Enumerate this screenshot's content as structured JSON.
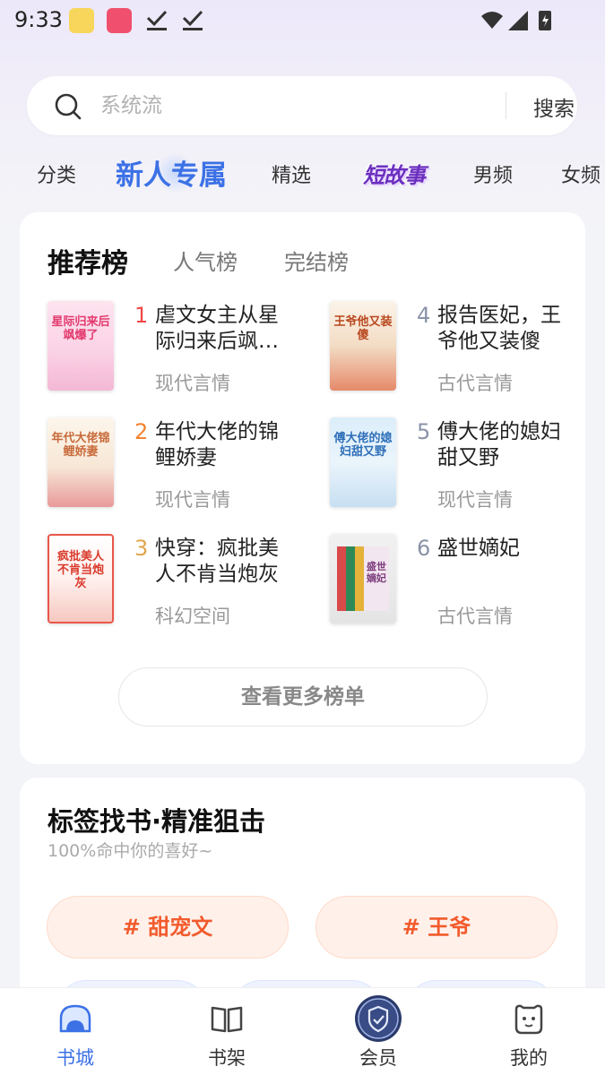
{
  "status_bar": {
    "time": "9:33"
  },
  "search": {
    "placeholder": "系统流",
    "button_label": "搜索"
  },
  "tabs": [
    {
      "label": "分类"
    },
    {
      "label": "新人专属",
      "active": true
    },
    {
      "label": "精选"
    },
    {
      "label": "短故事"
    },
    {
      "label": "男频"
    },
    {
      "label": "女频"
    }
  ],
  "ranking": {
    "tabs": [
      {
        "label": "推荐榜",
        "active": true
      },
      {
        "label": "人气榜"
      },
      {
        "label": "完结榜"
      }
    ],
    "books": [
      {
        "rank": "1",
        "title": "虐文女主从星际归来后飒爆了",
        "genre": "现代言情",
        "cover_text": "星际归来后飒爆了",
        "rank_color": "#f04848"
      },
      {
        "rank": "2",
        "title": "年代大佬的锦鲤娇妻",
        "genre": "现代言情",
        "cover_text": "年代大佬锦鲤娇妻",
        "rank_color": "#f5832e"
      },
      {
        "rank": "3",
        "title": "快穿：疯批美人不肯当炮灰",
        "genre": "科幻空间",
        "cover_text": "疯批美人不肯当炮灰",
        "rank_color": "#e0a64d"
      },
      {
        "rank": "4",
        "title": "报告医妃，王爷他又装傻",
        "genre": "古代言情",
        "cover_text": "王爷他又装傻",
        "rank_color": "#8a93a8"
      },
      {
        "rank": "5",
        "title": "傅大佬的媳妇甜又野",
        "genre": "现代言情",
        "cover_text": "傅大佬的媳妇甜又野",
        "rank_color": "#8a93a8"
      },
      {
        "rank": "6",
        "title": "盛世嫡妃",
        "genre": "古代言情",
        "cover_text": "盛世嫡妃",
        "rank_color": "#8a93a8"
      }
    ],
    "more_label": "查看更多榜单"
  },
  "tags_section": {
    "title": "标签找书·精准狙击",
    "subtitle": "100%命中你的喜好~",
    "tags": [
      {
        "label": "# 甜宠文"
      },
      {
        "label": "# 王爷"
      }
    ]
  },
  "bottom_nav": [
    {
      "label": "书城",
      "icon": "bookstore-icon",
      "active": true
    },
    {
      "label": "书架",
      "icon": "bookshelf-icon"
    },
    {
      "label": "会员",
      "icon": "vip-shield-icon"
    },
    {
      "label": "我的",
      "icon": "profile-icon"
    }
  ],
  "colors": {
    "accent": "#3c71e6",
    "tag_text": "#f25b2d"
  }
}
